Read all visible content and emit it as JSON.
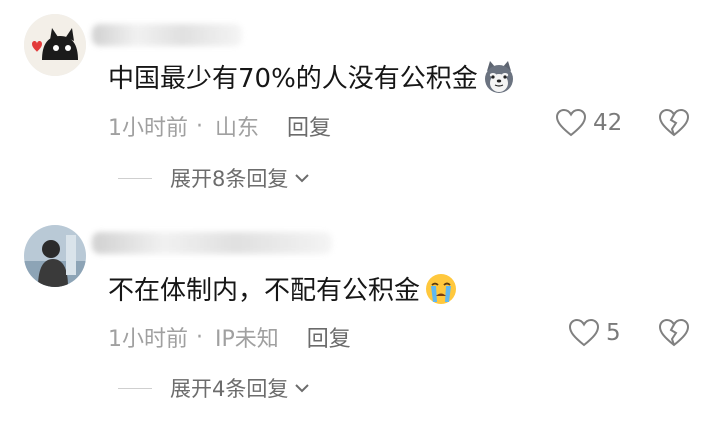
{
  "comments": [
    {
      "text": "中国最少有70%的人没有公积金",
      "time": "1小时前",
      "location": "山东",
      "reply_label": "回复",
      "like_count": "42",
      "expand_label": "展开8条回复"
    },
    {
      "text": "不在体制内，不配有公积金",
      "time": "1小时前",
      "location": "IP未知",
      "reply_label": "回复",
      "like_count": "5",
      "expand_label": "展开4条回复"
    }
  ],
  "separator": "·",
  "colors": {
    "text": "#161616",
    "meta": "#a0a0a0",
    "action": "#6b6b6b"
  }
}
